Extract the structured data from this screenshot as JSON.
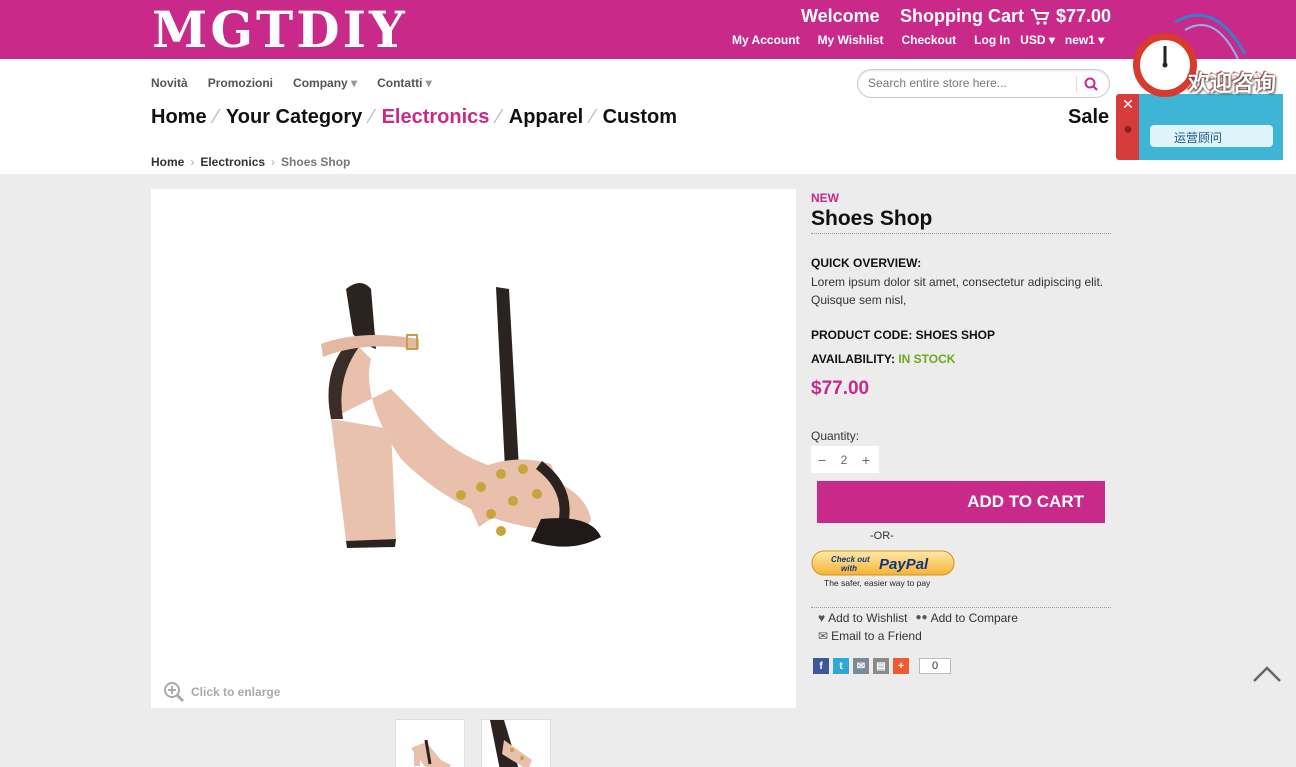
{
  "header": {
    "logo": "MGTDIY",
    "welcome": "Welcome",
    "cart_label": "Shopping Cart",
    "cart_total": "$77.00",
    "links": [
      "My Account",
      "My Wishlist",
      "Checkout",
      "Log In",
      "USD",
      "new1"
    ]
  },
  "subnav": [
    "Novità",
    "Promozioni",
    "Company",
    "Contatti"
  ],
  "search": {
    "placeholder": "Search entire store here..."
  },
  "mainnav": {
    "items": [
      "Home",
      "Your Category",
      "Electronics",
      "Apparel",
      "Custom"
    ],
    "sale": "Sale"
  },
  "breadcrumb": [
    "Home",
    "Electronics",
    "Shoes Shop"
  ],
  "product": {
    "badge": "NEW",
    "title": "Shoes Shop",
    "overview_label": "QUICK OVERVIEW:",
    "overview_text": "Lorem ipsum dolor sit amet, consectetur adipiscing elit. Quisque sem nisl,",
    "code_label": "PRODUCT CODE: SHOES SHOP",
    "availability_label": "AVAILABILITY:",
    "availability_value": "IN STOCK",
    "price": "$77.00",
    "quantity_label": "Quantity:",
    "quantity": "2",
    "add_to_cart": "ADD TO CART",
    "or": "-OR-",
    "paypal_line1": "Check out",
    "paypal_line2": "with",
    "paypal_brand": "PayPal",
    "paypal_tagline": "The safer, easier way to pay",
    "wishlist": "Add to Wishlist",
    "compare": "Add to Compare",
    "email": "Email to a Friend",
    "share_count": "0",
    "enlarge": "Click to enlarge"
  },
  "chat": {
    "welcome": "欢迎咨询",
    "button": "运营顾问"
  },
  "colors": {
    "brand": "#c92a8a",
    "stock": "#6aaa1c",
    "chat": "#3eb4d6"
  }
}
